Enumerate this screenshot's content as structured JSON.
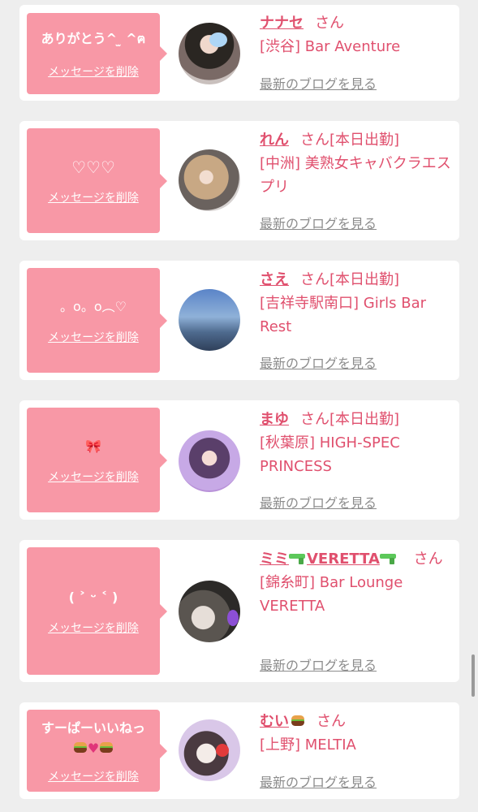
{
  "delete_label": "メッセージを削除",
  "blog_label": "最新のブログを見る",
  "san": "さん",
  "colors": {
    "accent": "#e0506e",
    "bubble": "#f898a6",
    "link_gray": "#8c8c8c",
    "background": "#eeeeee"
  },
  "entries": [
    {
      "message": "ありがとう^ ̫ ^ฅ",
      "name": "ナナセ",
      "status": "",
      "shop": "[渋谷] Bar Aventure"
    },
    {
      "message": "♡♡♡",
      "name": "れん",
      "status": "[本日出勤]",
      "shop": "[中洲] 美熟女キャバクラエスプリ"
    },
    {
      "message": "。o。o︵♡",
      "name": "さえ",
      "status": "[本日出勤]",
      "shop": "[吉祥寺駅南口] Girls Bar Rest"
    },
    {
      "message": "🎀",
      "name": "まゆ",
      "status": "[本日出勤]",
      "shop": "[秋葉原] HIGH-SPEC PRINCESS"
    },
    {
      "message": "( ˃ ᵕ ˂ )",
      "name": "ミミ",
      "name_suffix": "VERETTA",
      "status": "",
      "shop": "[錦糸町] Bar Lounge VERETTA"
    },
    {
      "message": "すーぱーいいねっ",
      "message_icons": [
        "hamburger-icon",
        "heart-icon",
        "hamburger-icon"
      ],
      "name": "むい",
      "status": "",
      "shop": "[上野] MELTIA"
    }
  ]
}
